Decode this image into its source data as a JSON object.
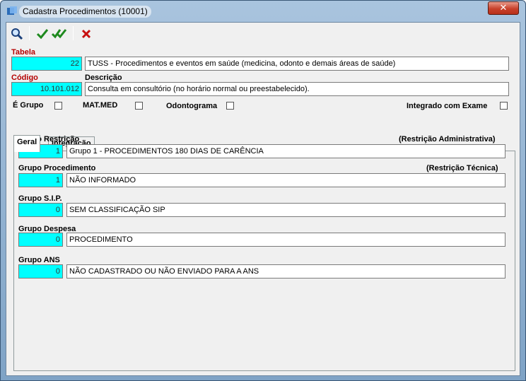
{
  "window": {
    "title": "Cadastra Procedimentos (10001)",
    "close_glyph": "✕"
  },
  "toolbar": {
    "icons": [
      "search-icon",
      "check-icon",
      "double-check-icon",
      "cancel-icon"
    ]
  },
  "tabela": {
    "label": "Tabela",
    "code": "22",
    "description": "TUSS - Procedimentos e eventos em saúde (medicina, odonto e demais áreas de saúde)"
  },
  "codigo": {
    "label": "Código",
    "value": "10.101.012"
  },
  "descricao": {
    "label": "Descrição",
    "value": "Consulta em consultório (no horário normal ou preestabelecido)."
  },
  "checks": {
    "e_grupo": "É Grupo",
    "mat_med": "MAT.MED",
    "odontograma": "Odontograma",
    "integrado": "Integrado com Exame"
  },
  "tabs": {
    "geral": "Geral",
    "integracao": "Integração"
  },
  "groups": {
    "restricao": {
      "label": "Grupo Restrição",
      "note": "(Restrição Administrativa)",
      "code": "1",
      "name": "Grupo 1 - PROCEDIMENTOS 180 DIAS DE CARÊNCIA"
    },
    "procedimento": {
      "label": "Grupo Procedimento",
      "note": "(Restrição Técnica)",
      "code": "1",
      "name": "NÃO INFORMADO"
    },
    "sip": {
      "label": "Grupo S.I.P.",
      "code": "0",
      "name": "SEM CLASSIFICAÇÃO SIP"
    },
    "despesa": {
      "label": "Grupo Despesa",
      "code": "0",
      "name": "PROCEDIMENTO"
    },
    "ans": {
      "label": "Grupo ANS",
      "code": "0",
      "name": "NÃO CADASTRADO OU NÃO ENVIADO PARA A ANS"
    }
  }
}
